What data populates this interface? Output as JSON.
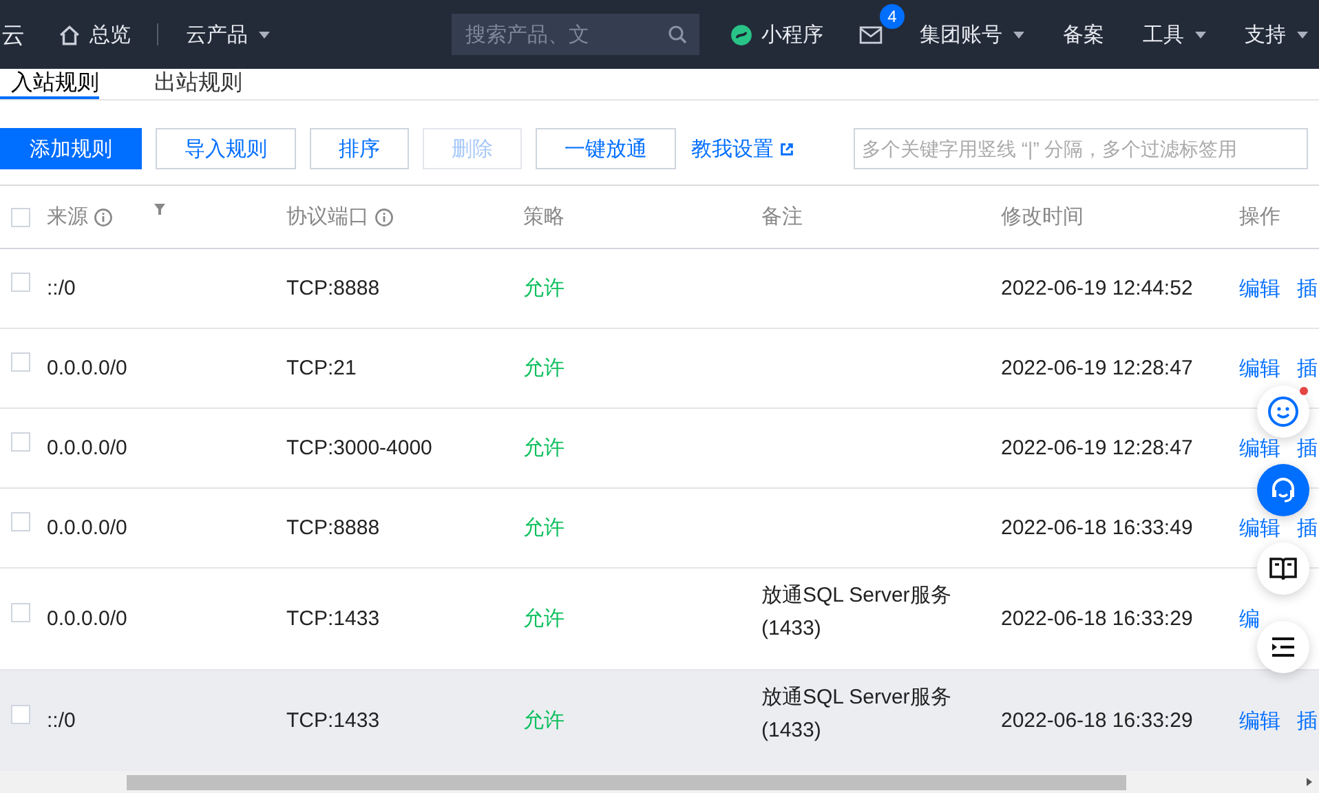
{
  "nav": {
    "logo": "云",
    "items": [
      {
        "kind": "home",
        "label": "总览"
      },
      {
        "kind": "dropdown",
        "label": "云产品"
      }
    ],
    "search": {
      "placeholder": "搜索产品、文"
    },
    "right": [
      {
        "kind": "mini",
        "label": "小程序"
      },
      {
        "kind": "mail",
        "badge": "4"
      },
      {
        "kind": "dropdown",
        "label": "集团账号"
      },
      {
        "kind": "plain",
        "label": "备案"
      },
      {
        "kind": "dropdown",
        "label": "工具"
      },
      {
        "kind": "dropdown",
        "label": "支持"
      }
    ]
  },
  "tabs": [
    {
      "label": "入站规则",
      "selected": true
    },
    {
      "label": "出站规则",
      "selected": false
    }
  ],
  "toolbar": {
    "buttons": [
      {
        "label": "添加规则",
        "kind": "primary",
        "disabled": false
      },
      {
        "label": "导入规则",
        "kind": "default",
        "disabled": false
      },
      {
        "label": "排序",
        "kind": "default",
        "disabled": false
      },
      {
        "label": "删除",
        "kind": "default",
        "disabled": true
      },
      {
        "label": "一键放通",
        "kind": "default",
        "disabled": false
      }
    ],
    "help_link": "教我设置",
    "filter": {
      "placeholder": "多个关键字用竖线 “|” 分隔，多个过滤标签用"
    }
  },
  "table": {
    "select_all_checked": false,
    "columns": [
      {
        "label": "来源",
        "info": true,
        "filter": true
      },
      {
        "label": "协议端口",
        "info": true,
        "filter": false
      },
      {
        "label": "策略",
        "info": false,
        "filter": false
      },
      {
        "label": "备注",
        "info": false,
        "filter": false
      },
      {
        "label": "修改时间",
        "info": false,
        "filter": false
      },
      {
        "label": "操作",
        "info": false,
        "filter": false
      }
    ],
    "rows": [
      {
        "source": "::/0",
        "port": "TCP:8888",
        "policy": "允许",
        "note": "",
        "time": "2022-06-19 12:44:52",
        "actions": [
          "编辑",
          "插"
        ],
        "checked": false,
        "highlighted": false
      },
      {
        "source": "0.0.0.0/0",
        "port": "TCP:21",
        "policy": "允许",
        "note": "",
        "time": "2022-06-19 12:28:47",
        "actions": [
          "编辑",
          "插"
        ],
        "checked": false,
        "highlighted": false
      },
      {
        "source": "0.0.0.0/0",
        "port": "TCP:3000-4000",
        "policy": "允许",
        "note": "",
        "time": "2022-06-19 12:28:47",
        "actions": [
          "编辑",
          "插"
        ],
        "checked": false,
        "highlighted": false
      },
      {
        "source": "0.0.0.0/0",
        "port": "TCP:8888",
        "policy": "允许",
        "note": "",
        "time": "2022-06-18 16:33:49",
        "actions": [
          "编辑",
          "插"
        ],
        "checked": false,
        "highlighted": false
      },
      {
        "source": "0.0.0.0/0",
        "port": "TCP:1433",
        "policy": "允许",
        "note": "放通SQL Server服务(1433)",
        "time": "2022-06-18 16:33:29",
        "actions": [
          "编"
        ],
        "checked": false,
        "highlighted": false
      },
      {
        "source": "::/0",
        "port": "TCP:1433",
        "policy": "允许",
        "note": "放通SQL Server服务(1433)",
        "time": "2022-06-18 16:33:29",
        "actions": [
          "编辑",
          "插"
        ],
        "checked": false,
        "highlighted": true
      }
    ]
  },
  "float_buttons": [
    {
      "kind": "smile",
      "dot": true
    },
    {
      "kind": "headset",
      "dot": false
    },
    {
      "kind": "book",
      "dot": false
    },
    {
      "kind": "list",
      "dot": false
    }
  ]
}
